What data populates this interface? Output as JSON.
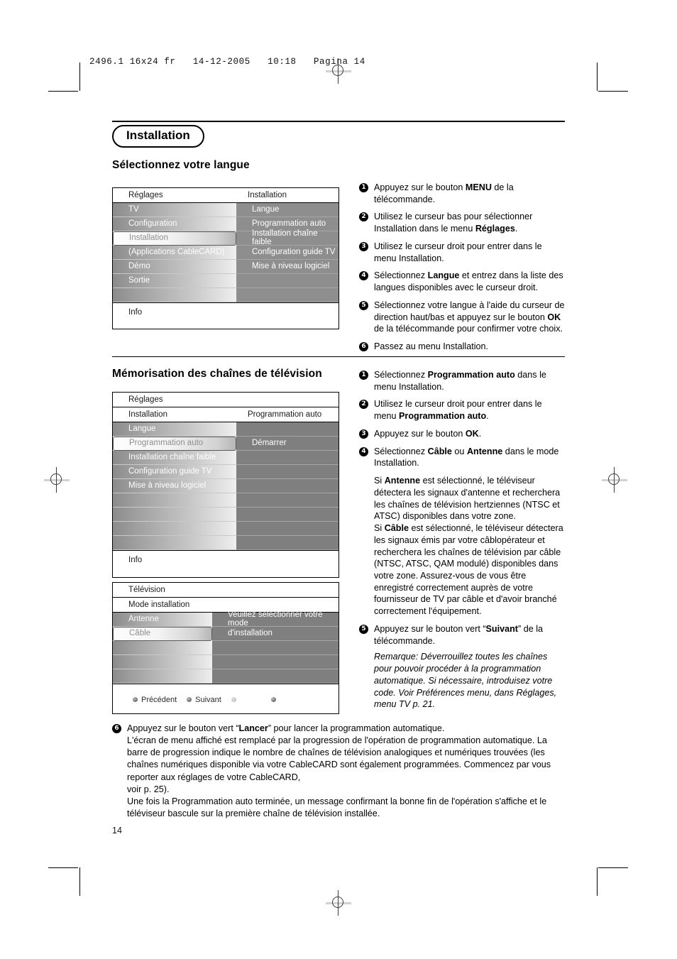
{
  "print_header": "2496.1 16x24 fr   14-12-2005   10:18   Pagina 14",
  "chapter_badge": "Installation",
  "page_number": "14",
  "section1": {
    "title": "Sélectionnez votre langue",
    "menu": {
      "header": [
        "Réglages",
        "Installation"
      ],
      "left_items": [
        {
          "label": "TV",
          "selected": false
        },
        {
          "label": "Configuration",
          "selected": false
        },
        {
          "label": "Installation",
          "selected": true
        },
        {
          "label": "(Applications CableCARD)",
          "selected": false
        },
        {
          "label": "Démo",
          "selected": false
        },
        {
          "label": "Sortie",
          "selected": false
        },
        {
          "label": "",
          "selected": false
        }
      ],
      "right_items": [
        {
          "label": "Langue"
        },
        {
          "label": "Programmation auto"
        },
        {
          "label": "Installation chaîne faible"
        },
        {
          "label": "Configuration guide TV"
        },
        {
          "label": "Mise à niveau logiciel"
        },
        {
          "label": ""
        },
        {
          "label": ""
        }
      ],
      "footer": "Info"
    },
    "steps": [
      {
        "n": "1",
        "html": "Appuyez sur le bouton <b>MENU</b> de la télécommande."
      },
      {
        "n": "2",
        "html": "Utilisez le curseur bas pour sélectionner Installation dans le menu <b>Réglages</b>."
      },
      {
        "n": "3",
        "html": "Utilisez le curseur droit pour entrer dans le menu Installation."
      },
      {
        "n": "4",
        "html": "Sélectionnez <b>Langue</b> et entrez dans la liste des langues disponibles avec le curseur droit."
      },
      {
        "n": "5",
        "html": "Sélectionnez votre langue à l'aide du curseur de direction haut/bas et appuyez sur le bouton <b>OK</b> de la télécommande pour confirmer votre choix."
      },
      {
        "n": "6",
        "html": "Passez au menu Installation."
      }
    ]
  },
  "section2": {
    "title": "Mémorisation des chaînes de télévision",
    "menu_a": {
      "title_row": "Réglages",
      "header": [
        "Installation",
        "Programmation auto"
      ],
      "left_items": [
        {
          "label": "Langue",
          "selected": false
        },
        {
          "label": "Programmation auto",
          "selected": true
        },
        {
          "label": "Installation chaîne faible",
          "selected": false
        },
        {
          "label": "Configuration guide TV",
          "selected": false
        },
        {
          "label": "Mise à niveau logiciel",
          "selected": false
        },
        {
          "label": "",
          "selected": false
        },
        {
          "label": "",
          "selected": false
        },
        {
          "label": "",
          "selected": false
        },
        {
          "label": "",
          "selected": false
        }
      ],
      "right_items": [
        {
          "label": ""
        },
        {
          "label": "Démarrer"
        },
        {
          "label": ""
        },
        {
          "label": ""
        },
        {
          "label": ""
        },
        {
          "label": ""
        },
        {
          "label": ""
        },
        {
          "label": ""
        },
        {
          "label": ""
        }
      ],
      "footer": "Info"
    },
    "menu_b": {
      "title_row": "Télévision",
      "header": [
        "Mode installation",
        ""
      ],
      "left_items": [
        {
          "label": "Antenne",
          "selected": false
        },
        {
          "label": "Câble",
          "selected": true
        },
        {
          "label": "",
          "selected": false
        },
        {
          "label": "",
          "selected": false
        },
        {
          "label": "",
          "selected": false
        }
      ],
      "right_items": [
        {
          "label": "Veuillez sélectionner votre mode"
        },
        {
          "label": "d'installation"
        },
        {
          "label": ""
        },
        {
          "label": ""
        },
        {
          "label": ""
        }
      ],
      "nav": [
        {
          "label": "Précédent",
          "style": "dot"
        },
        {
          "label": "Suivant",
          "style": "dot"
        },
        {
          "label": "",
          "style": "dot-faint"
        },
        {
          "label": "",
          "style": "dot"
        }
      ]
    },
    "steps": [
      {
        "n": "1",
        "html": "Sélectionnez <b>Programmation auto</b> dans le menu Installation."
      },
      {
        "n": "2",
        "html": "Utilisez le curseur droit pour entrer dans le menu <b>Programmation auto</b>."
      },
      {
        "n": "3",
        "html": "Appuyez sur le bouton <b>OK</b>."
      },
      {
        "n": "4",
        "html": "Sélectionnez <b>Câble</b> ou <b>Antenne</b> dans le mode Installation."
      },
      {
        "n": "5",
        "html": "Appuyez sur le bouton vert “<b>Suivant</b>” de la télécommande."
      }
    ],
    "note_after_step4": "Si <b>Antenne</b> est sélectionné, le téléviseur détectera les signaux d'antenne et recherchera les chaînes de télévision hertziennes (NTSC et ATSC) disponibles dans votre zone.<br>Si <b>Câble</b> est sélectionné, le téléviseur détectera les signaux émis par votre câblopérateur et recherchera les chaînes de télévision par câble (NTSC, ATSC, QAM modulé) disponibles dans votre zone. Assurez-vous de vous être enregistré correctement auprès de votre fournisseur de TV par câble et d'avoir branché correctement l'équipement.",
    "remark": "Remarque: Déverrouillez toutes les chaînes pour pouvoir procéder à la programmation automatique. Si nécessaire, introduisez votre code. Voir Préférences menu, dans Réglages, menu TV p. 21."
  },
  "bottom_step": {
    "n": "6",
    "html": "Appuyez sur le bouton vert “<b>Lancer</b>” pour lancer la programmation automatique.<br>L'écran de menu affiché est remplacé par la progression de l'opération de programmation automatique. La barre de progression indique le nombre de chaînes de télévision analogiques et numériques trouvées (les chaînes numériques disponible via votre CableCARD sont également programmées. Commencez par vous reporter aux réglages de votre CableCARD,<br>voir p. 25).<br>Une fois la Programmation auto terminée, un message confirmant la bonne fin de l'opération s'affiche et le téléviseur bascule sur la première chaîne de télévision installée."
  }
}
